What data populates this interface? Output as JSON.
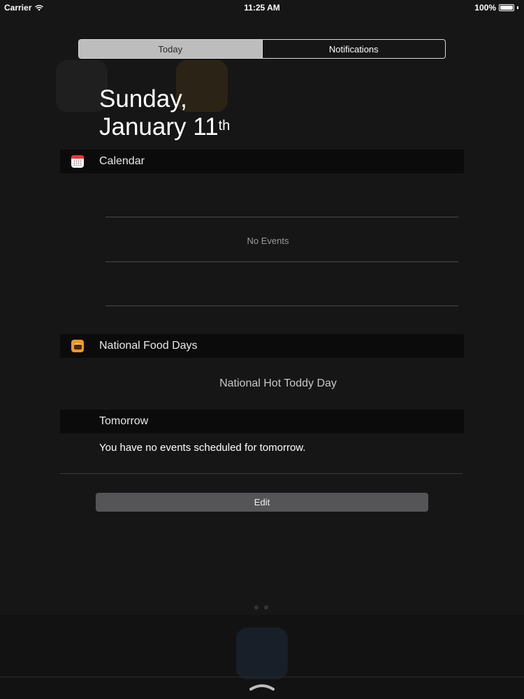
{
  "status_bar": {
    "carrier": "Carrier",
    "time": "11:25 AM",
    "battery": "100%",
    "battery_level": 1.0,
    "wifi_icon": "wifi-icon",
    "battery_icon": "battery-icon"
  },
  "segments": {
    "today": "Today",
    "notifications": "Notifications",
    "selected": "Today"
  },
  "date": {
    "line1": "Sunday,",
    "line2": "January 11",
    "suffix": "th"
  },
  "calendar": {
    "title": "Calendar",
    "icon": "calendar-icon",
    "empty_text": "No Events"
  },
  "food_days": {
    "title": "National Food Days",
    "icon": "food-icon",
    "today_item": "National Hot Toddy Day"
  },
  "tomorrow": {
    "title": "Tomorrow",
    "text": "You have no events scheduled for tomorrow."
  },
  "edit_label": "Edit",
  "colors": {
    "background": "#161617",
    "header_bg": "#0b0b0c",
    "segment_active": "#bdbdbd",
    "edit_button": "#555557",
    "food_accent": "#f29a1c",
    "calendar_red": "#e53935"
  }
}
